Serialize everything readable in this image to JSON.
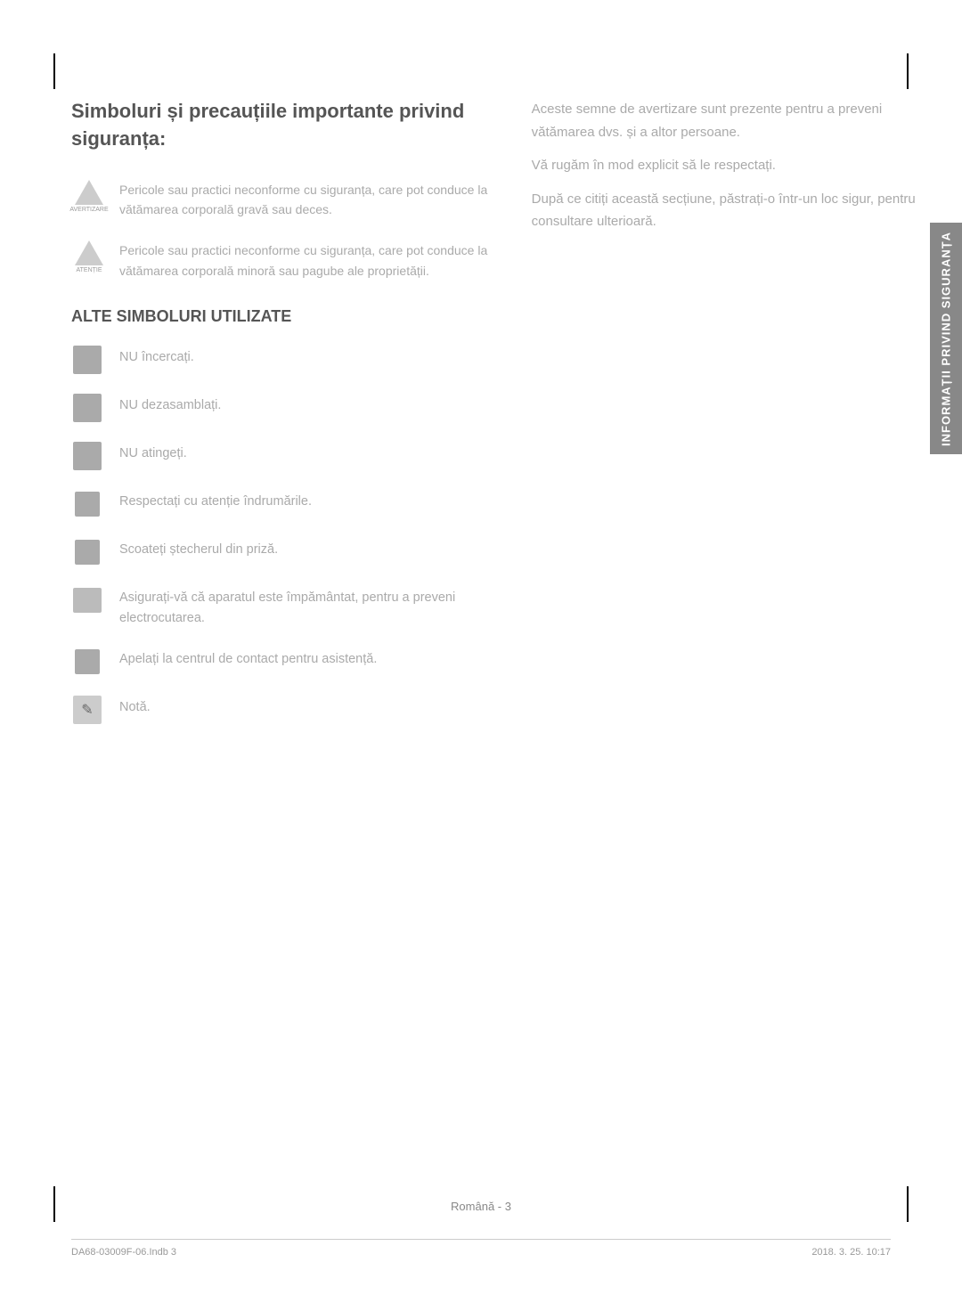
{
  "page": {
    "title": "Simboluri și precauțiile importante privind siguranța:",
    "sidebar_label": "INFORMAȚII PRIVIND SIGURANȚA",
    "left_column": {
      "warning_blocks": [
        {
          "icon_label": "AVERTIZARE",
          "text": "Pericole sau practici neconforme cu siguranța, care pot conduce la vătămarea corporală gravă sau deces."
        },
        {
          "icon_label": "ATENȚIE",
          "text": "Pericole sau practici neconforme cu siguranța, care pot conduce la vătămarea corporală minoră sau pagube ale proprietății."
        }
      ],
      "alt_section_title": "ALTE SIMBOLURI UTILIZATE",
      "symbol_items": [
        {
          "icon_type": "square",
          "text": "NU încercați."
        },
        {
          "icon_type": "square",
          "text": "NU dezasamblați."
        },
        {
          "icon_type": "square",
          "text": "NU atingeți."
        },
        {
          "icon_type": "square-sm",
          "text": "Respectați cu atenție îndrumările."
        },
        {
          "icon_type": "square-sm",
          "text": "Scoateți ștecherul din priză."
        },
        {
          "icon_type": "grounded",
          "text": "Asigurați-vă că aparatul este împământat, pentru a preveni electrocutarea."
        },
        {
          "icon_type": "square-sm",
          "text": "Apelați la centrul de contact pentru asistență."
        },
        {
          "icon_type": "note",
          "text": "Notă."
        }
      ]
    },
    "right_column": {
      "paragraphs": [
        "Aceste semne de avertizare sunt prezente pentru a preveni vătămarea dvs. și a altor persoane.",
        "Vă rugăm în mod explicit să le respectați.",
        "După ce citiți această secțiune, păstrați-o într-un loc sigur, pentru consultare ulterioară."
      ]
    },
    "footer": {
      "left": "DA68-03009F-06.Indb  3",
      "center": "Română - 3",
      "right": "2018. 3. 25.     10:17"
    }
  }
}
